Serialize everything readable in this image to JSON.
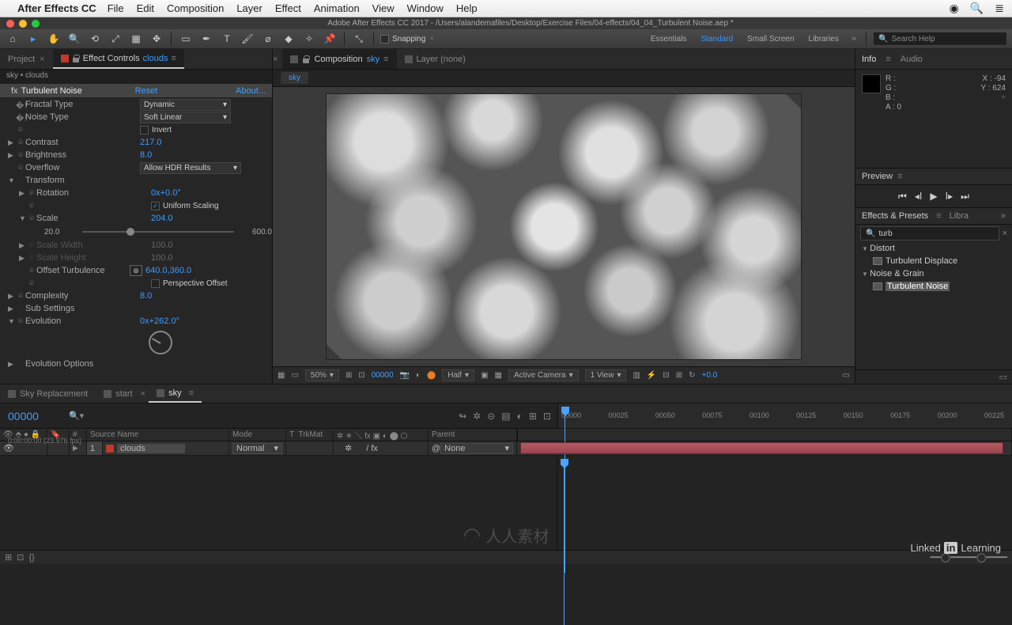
{
  "menubar": {
    "app": "After Effects CC",
    "items": [
      "File",
      "Edit",
      "Composition",
      "Layer",
      "Effect",
      "Animation",
      "View",
      "Window",
      "Help"
    ]
  },
  "window_title": "Adobe After Effects CC 2017 - /Users/alandemafiles/Desktop/Exercise Files/04-effects/04_04_Turbulent Noise.aep *",
  "toolbar": {
    "snapping": "Snapping",
    "workspaces": [
      "Essentials",
      "Standard",
      "Small Screen",
      "Libraries"
    ],
    "active_ws": "Standard",
    "search_ph": "Search Help"
  },
  "left": {
    "tab_project": "Project",
    "tab_ec": "Effect Controls",
    "tab_ec_link": "clouds",
    "crumb": "sky • clouds",
    "effect_name": "Turbulent Noise",
    "reset": "Reset",
    "about": "About...",
    "props": {
      "fractal_type": "Fractal Type",
      "fractal_type_v": "Dynamic",
      "noise_type": "Noise Type",
      "noise_type_v": "Soft Linear",
      "invert": "Invert",
      "contrast": "Contrast",
      "contrast_v": "217.0",
      "brightness": "Brightness",
      "brightness_v": "8.0",
      "overflow": "Overflow",
      "overflow_v": "Allow HDR Results",
      "transform": "Transform",
      "rotation": "Rotation",
      "rotation_v": "0x+0.0°",
      "uniform": "Uniform Scaling",
      "scale": "Scale",
      "scale_v": "204.0",
      "scale_min": "20.0",
      "scale_max": "600.0",
      "scale_w": "Scale Width",
      "scale_w_v": "100.0",
      "scale_h": "Scale Height",
      "scale_h_v": "100.0",
      "off_turb": "Offset Turbulence",
      "off_turb_v": "640.0,360.0",
      "persp": "Perspective Offset",
      "complexity": "Complexity",
      "complexity_v": "8.0",
      "sub": "Sub Settings",
      "evolution": "Evolution",
      "evolution_v": "0x+262.0°",
      "evo_opt": "Evolution Options"
    }
  },
  "center": {
    "tab_comp": "Composition",
    "tab_comp_link": "sky",
    "tab_layer": "Layer (none)",
    "crumb_chip": "sky",
    "bar": {
      "zoom": "50%",
      "time": "00000",
      "res": "Half",
      "camera": "Active Camera",
      "views": "1 View",
      "exposure": "+0.0"
    }
  },
  "right": {
    "info": "Info",
    "audio": "Audio",
    "R": "R :",
    "G": "G :",
    "B": "B :",
    "A": "A : 0",
    "X": "X : -94",
    "Y": "Y : 624",
    "preview": "Preview",
    "eff_presets": "Effects & Presets",
    "libra": "Libra",
    "search": "turb",
    "cat1": "Distort",
    "item1": "Turbulent Displace",
    "cat2": "Noise & Grain",
    "item2": "Turbulent Noise"
  },
  "timeline": {
    "tabs": [
      "Sky Replacement",
      "start",
      "sky"
    ],
    "active": 2,
    "tc": "00000",
    "fps": "0:00:00:00 (23.976 fps)",
    "cols": {
      "src": "Source Name",
      "mode": "Mode",
      "trk": "TrkMat",
      "par": "Parent"
    },
    "ticks": [
      "00000",
      "00025",
      "00050",
      "00075",
      "00100",
      "00125",
      "00150",
      "00175",
      "00200",
      "00225"
    ],
    "layer": {
      "num": "1",
      "name": "clouds",
      "mode": "Normal",
      "parent": "None"
    }
  },
  "branding": {
    "wm": "人人素材",
    "li1": "Linked",
    "li2": "in",
    "li3": "Learning"
  }
}
